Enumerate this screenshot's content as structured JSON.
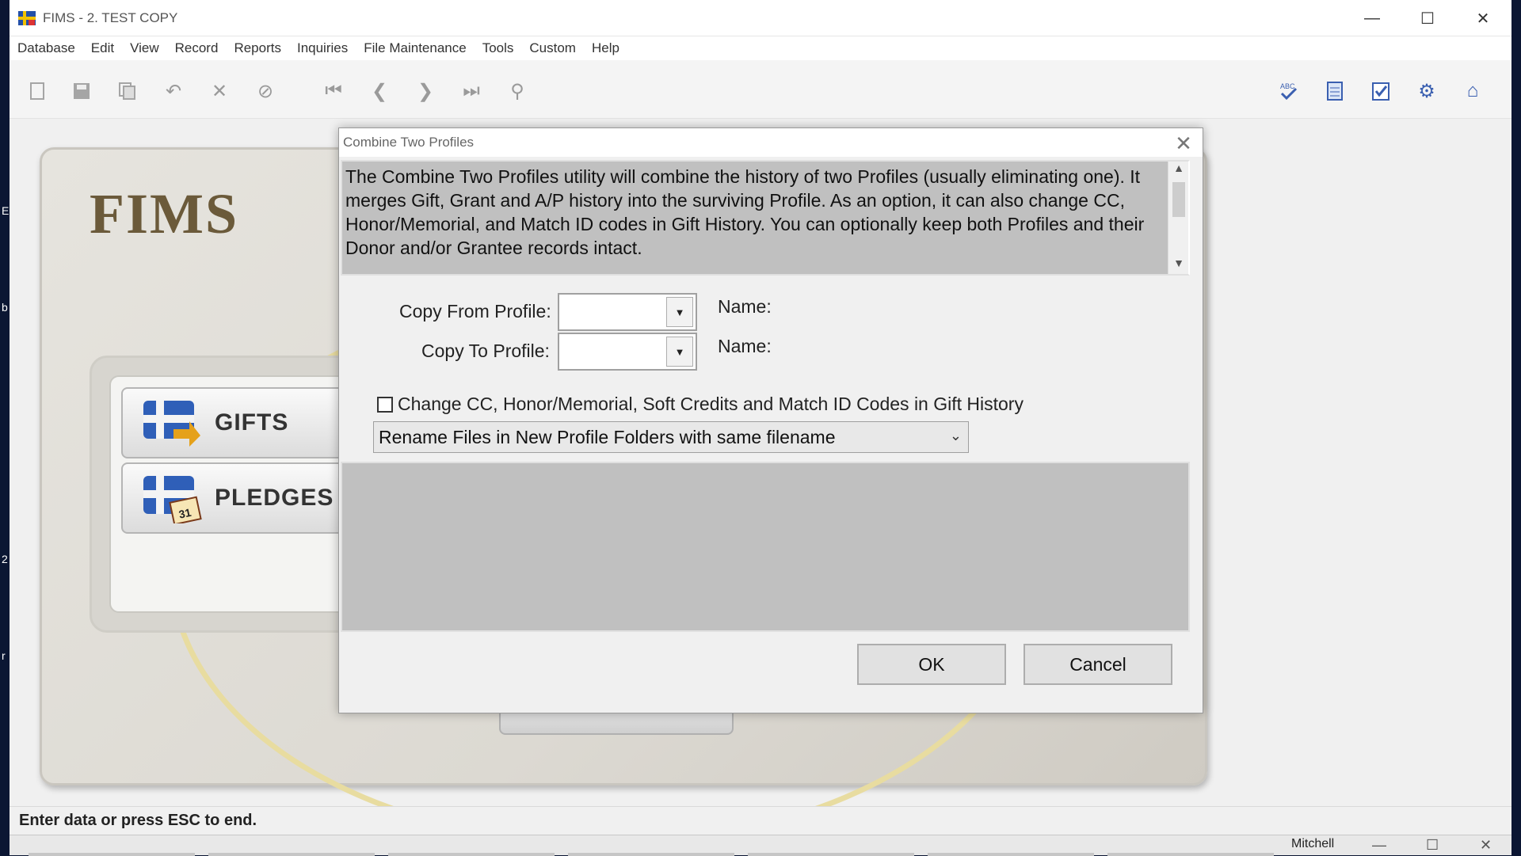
{
  "window": {
    "title": "FIMS - 2. TEST COPY",
    "minimize_glyph": "—",
    "maximize_glyph": "☐",
    "close_glyph": "✕"
  },
  "left_strip_chars": [
    "E",
    "b",
    "2",
    "r"
  ],
  "menu": [
    "Database",
    "Edit",
    "View",
    "Record",
    "Reports",
    "Inquiries",
    "File Maintenance",
    "Tools",
    "Custom",
    "Help"
  ],
  "toolbar": {
    "left_icons": [
      "new-record-icon",
      "save-icon",
      "copy-icon",
      "undo-icon",
      "delete-icon",
      "cancel-icon",
      "first-record-icon",
      "previous-record-icon",
      "next-record-icon",
      "last-record-icon",
      "find-icon"
    ],
    "right_icons": [
      "spell-check-icon",
      "notes-icon",
      "checklist-icon",
      "settings-icon",
      "home-icon"
    ]
  },
  "main": {
    "logo": "FIMS",
    "tiles": [
      {
        "label": "GIFTS",
        "icon": "gifts-icon"
      },
      {
        "label": "PLEDGES",
        "icon": "pledges-icon"
      }
    ]
  },
  "dialog": {
    "title": "Combine Two Profiles",
    "close_glyph": "✕",
    "description": "The Combine Two Profiles utility will combine the history of two Profiles (usually eliminating one). It merges Gift, Grant and A/P history into the surviving Profile. As an option, it can also change CC, Honor/Memorial, and Match ID codes in Gift History. You can optionally keep both Profiles and their Donor and/or Grantee records intact.",
    "copy_from_label": "Copy From Profile:",
    "copy_from_value": "",
    "copy_to_label": "Copy To Profile:",
    "copy_to_value": "",
    "name_label_1": "Name:",
    "name_label_2": "Name:",
    "change_codes_label": "Change CC, Honor/Memorial, Soft Credits and Match ID Codes in Gift History",
    "change_codes_checked": false,
    "rename_option": "Rename Files in New Profile Folders with same filename",
    "ok_label": "OK",
    "cancel_label": "Cancel"
  },
  "status": {
    "message": "Enter data or press ESC to end.",
    "user": "Mitchell"
  },
  "colors": {
    "accent": "#3a5fb0",
    "panel_bg": "#c0c0c0",
    "desktop": "#0b1633"
  }
}
